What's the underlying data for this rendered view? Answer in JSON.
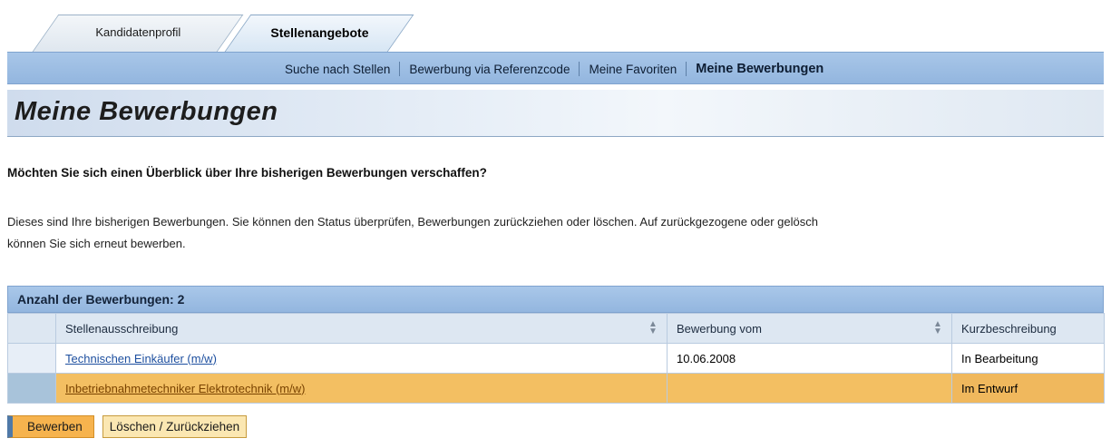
{
  "tabs": [
    {
      "label": "Kandidatenprofil",
      "active": false
    },
    {
      "label": "Stellenangebote",
      "active": true
    }
  ],
  "subnav": {
    "items": [
      {
        "label": "Suche nach Stellen"
      },
      {
        "label": "Bewerbung via Referenzcode"
      },
      {
        "label": "Meine Favoriten"
      },
      {
        "label": "Meine Bewerbungen",
        "active": true
      }
    ]
  },
  "page": {
    "title": "Meine Bewerbungen",
    "question": "Möchten Sie sich einen Überblick über Ihre bisherigen Bewerbungen verschaffen?",
    "description_line1": "Dieses sind Ihre bisherigen Bewerbungen. Sie können den Status überprüfen, Bewerbungen zurückziehen oder löschen. Auf zurückgezogene oder gelösch",
    "description_line2": "können Sie sich erneut bewerben."
  },
  "table": {
    "title": "Anzahl der Bewerbungen: 2",
    "columns": [
      "Stellenausschreibung",
      "Bewerbung vom",
      "Kurzbeschreibung"
    ],
    "rows": [
      {
        "position": "Technischen Einkäufer (m/w)",
        "date": "10.06.2008",
        "status": "In Bearbeitung"
      },
      {
        "position": "Inbetriebnahmetechniker Elektrotechnik (m/w)",
        "date": "",
        "status": "Im Entwurf"
      }
    ]
  },
  "buttons": {
    "apply": "Bewerben",
    "delete": "Löschen / Zurückziehen"
  },
  "colors": {
    "nav_blue": "#93b6df",
    "selected_row": "#f3bf62",
    "primary_button": "#f6b34e",
    "link": "#1d4f9f"
  },
  "icons": {
    "sort": "sort-up-down-icon"
  }
}
